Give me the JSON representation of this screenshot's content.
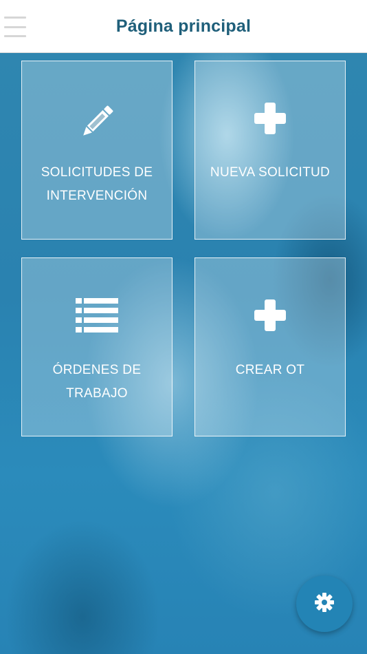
{
  "header": {
    "title": "Página principal",
    "menu_icon": "hamburger-menu-icon"
  },
  "tiles": [
    {
      "label": "SOLICITUDES DE INTERVENCIÓN",
      "icon": "pencil-icon"
    },
    {
      "label": "NUEVA SOLICITUD",
      "icon": "plus-icon"
    },
    {
      "label": "ÓRDENES DE TRABAJO",
      "icon": "list-icon"
    },
    {
      "label": "CREAR OT",
      "icon": "plus-icon"
    }
  ],
  "fab": {
    "icon": "gear-icon"
  },
  "colors": {
    "header_bg": "#ffffff",
    "title": "#1f5f7a",
    "background": "#2a82b0",
    "fab": "#2384b5",
    "tile_text": "#ffffff"
  }
}
